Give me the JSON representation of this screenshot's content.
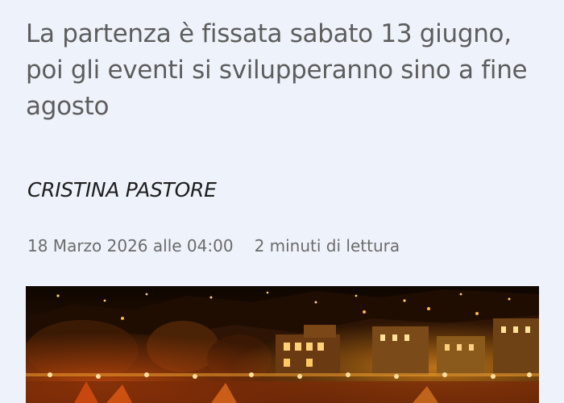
{
  "article": {
    "subtitle": "La partenza è fissata sabato 13 giugno, poi gli eventi si svilupperanno sino a fine agosto",
    "author": "CRISTINA PASTORE",
    "date": "18 Marzo 2026 alle 04:00",
    "reading_time": "2 minuti di lettura"
  },
  "colors": {
    "page_background": "#eef3fb",
    "subtitle_text": "#5d5d5d",
    "author_text": "#1e1e1e",
    "meta_text": "#6b6b6b"
  }
}
